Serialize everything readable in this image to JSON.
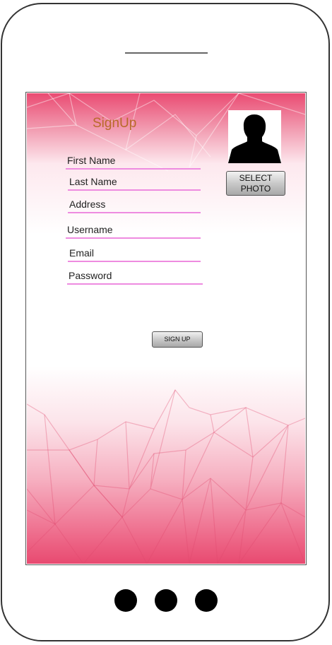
{
  "page": {
    "title": "SignUp"
  },
  "form": {
    "fields": [
      {
        "label": "First Name"
      },
      {
        "label": "Last Name"
      },
      {
        "label": "Address"
      },
      {
        "label": "Username"
      },
      {
        "label": "Email"
      },
      {
        "label": "Password"
      }
    ],
    "select_photo_label": "SELECT\nPHOTO",
    "sign_up_label": "SIGN UP"
  },
  "icons": {
    "avatar": "user-silhouette-icon",
    "home_buttons": [
      "home-dot-icon",
      "home-dot-icon",
      "home-dot-icon"
    ]
  },
  "colors": {
    "title": "#b86a2a",
    "field_underline": "#ee8be0",
    "background_pink": "#e84a70"
  }
}
